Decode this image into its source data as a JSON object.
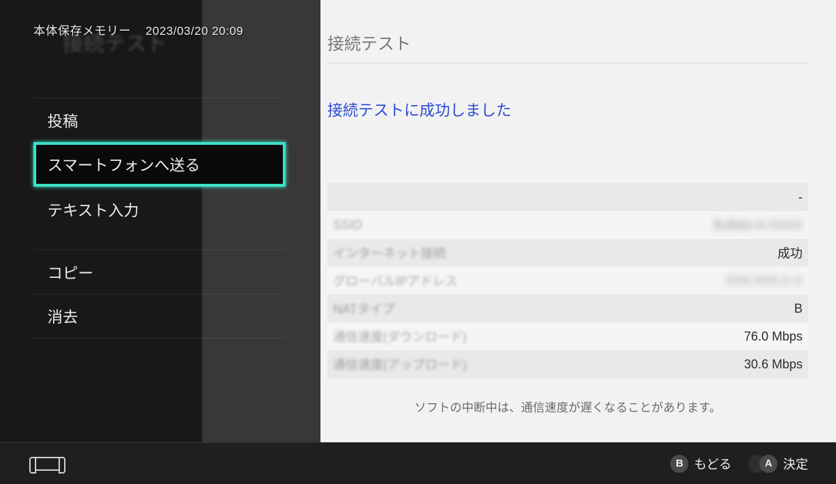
{
  "bg": {
    "title": "接続テスト",
    "success_message": "接続テストに成功しました",
    "rows": [
      {
        "label": "",
        "value": "-"
      },
      {
        "label": "SSID",
        "value": "Buffalo-A-XXXX"
      },
      {
        "label": "インターネット接続",
        "value": "成功"
      },
      {
        "label": "グローバルIPアドレス",
        "value": "XXX.XXX.X.X"
      },
      {
        "label": "NATタイプ",
        "value": "B"
      },
      {
        "label": "通信速度(ダウンロード)",
        "value": "76.0 Mbps"
      },
      {
        "label": "通信速度(アップロード)",
        "value": "30.6 Mbps"
      }
    ],
    "note": "ソフトの中断中は、通信速度が遅くなることがあります。"
  },
  "header": {
    "ghost_title": "接続テスト",
    "storage_label": "本体保存メモリー",
    "timestamp": "2023/03/20 20:09"
  },
  "menu": {
    "items": [
      {
        "label": "投稿",
        "selected": false,
        "name": "menu-post"
      },
      {
        "label": "スマートフォンへ送る",
        "selected": true,
        "name": "menu-send-to-smartphone"
      },
      {
        "label": "テキスト入力",
        "selected": false,
        "name": "menu-text-input"
      },
      {
        "label": "コピー",
        "selected": false,
        "name": "menu-copy",
        "gap_before": true
      },
      {
        "label": "消去",
        "selected": false,
        "name": "menu-delete"
      }
    ]
  },
  "footer": {
    "b_label": "もどる",
    "a_label": "決定",
    "b_glyph": "B",
    "a_glyph": "A"
  }
}
